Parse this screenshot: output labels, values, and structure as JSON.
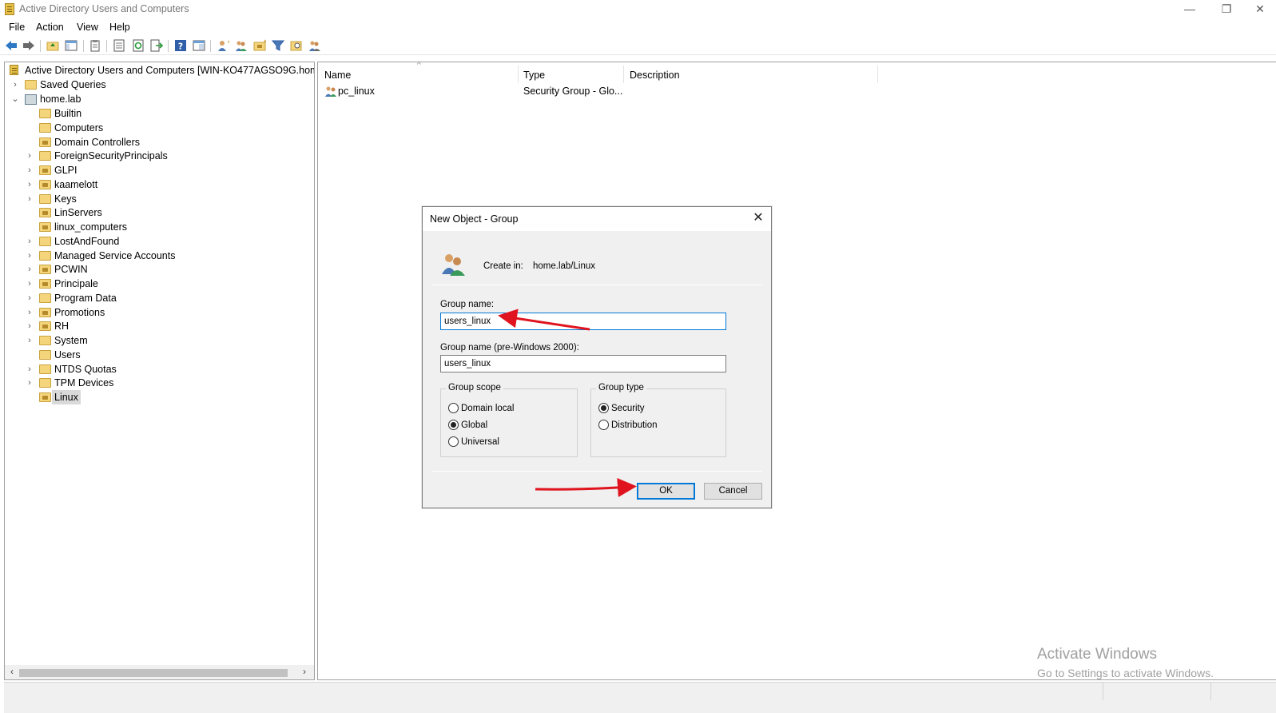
{
  "window": {
    "title": "Active Directory Users and Computers",
    "minimize": "—",
    "restore": "❐",
    "close": "✕"
  },
  "menu": [
    "File",
    "Action",
    "View",
    "Help"
  ],
  "tree": {
    "root": "Active Directory Users and Computers [WIN-KO477AGSO9G.home.lal",
    "saved_queries": "Saved Queries",
    "domain": "home.lab",
    "children": [
      "Builtin",
      "Computers",
      "Domain Controllers",
      "ForeignSecurityPrincipals",
      "GLPI",
      "kaamelott",
      "Keys",
      "LinServers",
      "linux_computers",
      "LostAndFound",
      "Managed Service Accounts",
      "PCWIN",
      "Principale",
      "Program Data",
      "Promotions",
      "RH",
      "System",
      "Users",
      "NTDS Quotas",
      "TPM Devices",
      "Linux"
    ],
    "selected": "Linux"
  },
  "list": {
    "columns": [
      "Name",
      "Type",
      "Description"
    ],
    "rows": [
      {
        "name": "pc_linux",
        "type": "Security Group - Glo...",
        "description": ""
      }
    ]
  },
  "dialog": {
    "title": "New Object - Group",
    "create_in_label": "Create in:",
    "create_in_value": "home.lab/Linux",
    "group_name_label": "Group name:",
    "group_name_value": "users_linux",
    "pre2000_label": "Group name (pre-Windows 2000):",
    "pre2000_value": "users_linux",
    "scope": {
      "title": "Group scope",
      "options": [
        "Domain local",
        "Global",
        "Universal"
      ],
      "selected": "Global"
    },
    "type": {
      "title": "Group type",
      "options": [
        "Security",
        "Distribution"
      ],
      "selected": "Security"
    },
    "ok_label": "OK",
    "cancel_label": "Cancel"
  },
  "watermark": {
    "line1": "Activate Windows",
    "line2": "Go to Settings to activate Windows."
  },
  "colors": {
    "accent": "#0078d7",
    "annotation_arrow": "#e0141e",
    "folder": "#f4d57b"
  }
}
